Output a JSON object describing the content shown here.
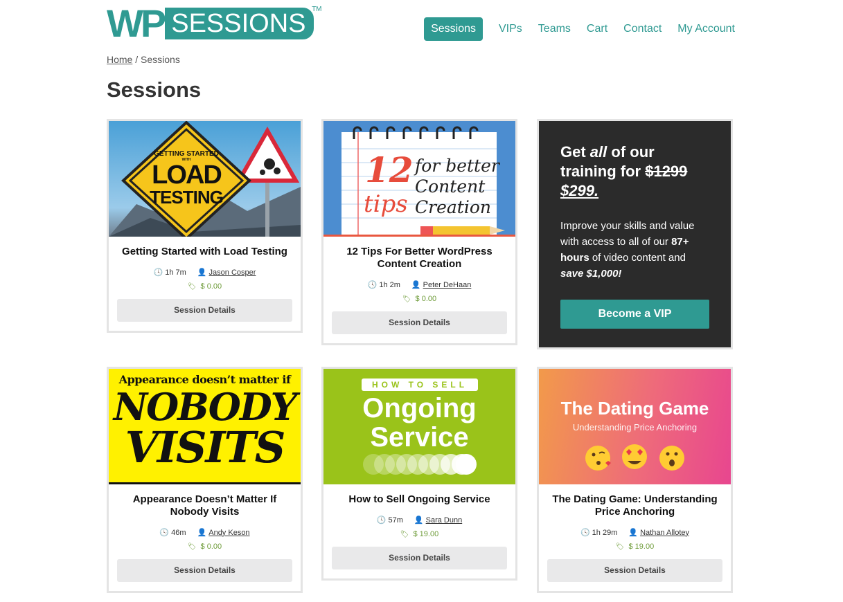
{
  "logo": {
    "wp": "WP",
    "sessions": "SESSIONS",
    "tm": "TM"
  },
  "nav": [
    {
      "label": "Sessions",
      "active": true
    },
    {
      "label": "VIPs"
    },
    {
      "label": "Teams"
    },
    {
      "label": "Cart"
    },
    {
      "label": "Contact"
    },
    {
      "label": "My Account"
    }
  ],
  "breadcrumb": {
    "home": "Home",
    "separator": "/",
    "current": "Sessions"
  },
  "page_title": "Sessions",
  "cards": [
    {
      "title": "Getting Started with Load Testing",
      "duration": "1h 7m",
      "author": "Jason Cosper",
      "price": "$ 0.00",
      "button": "Session Details",
      "image_text": [
        "GETTING STARTED",
        "WITH",
        "LOAD",
        "TESTING"
      ]
    },
    {
      "title": "12 Tips For Better WordPress Content Creation",
      "duration": "1h 2m",
      "author": "Peter DeHaan",
      "price": "$ 0.00",
      "button": "Session Details",
      "image_text": [
        "12",
        "tips",
        "for better",
        "Content",
        "Creation"
      ]
    },
    {
      "title": "Appearance Doesn’t Matter If Nobody Visits",
      "duration": "46m",
      "author": "Andy Keson",
      "price": "$ 0.00",
      "button": "Session Details",
      "image_text": [
        "Appearance doesn’t matter if",
        "NOBODY",
        "VISITS"
      ]
    },
    {
      "title": "How to Sell Ongoing Service",
      "duration": "57m",
      "author": "Sara Dunn",
      "price": "$ 19.00",
      "button": "Session Details",
      "image_text": [
        "HOW TO SELL",
        "Ongoing",
        "Service"
      ]
    },
    {
      "title": "The Dating Game: Understanding Price Anchoring",
      "duration": "1h 29m",
      "author": "Nathan Allotey",
      "price": "$ 19.00",
      "button": "Session Details",
      "image_text": [
        "The Dating Game",
        "Understanding Price Anchoring"
      ]
    }
  ],
  "vip": {
    "heading_pre": "Get ",
    "heading_em": "all",
    "heading_mid": " of our training for ",
    "old_price": "$1299",
    "new_price": "$299.",
    "body_pre": "Improve your skills and value with access to all of our ",
    "body_bold": "87+ hours",
    "body_mid": " of video content and ",
    "body_em": "save $1,000!",
    "button": "Become a VIP"
  },
  "colors": {
    "brand": "#2f9a92",
    "price": "#6f9c3a",
    "vip_bg": "#2b2b2b"
  },
  "icons": {
    "duration": "clock-icon",
    "author": "user-icon",
    "price": "price-tag-icon"
  }
}
